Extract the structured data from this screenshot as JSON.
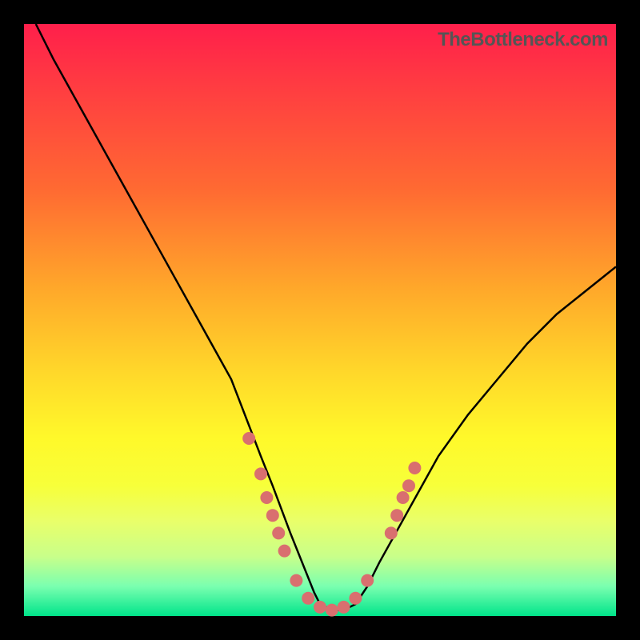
{
  "watermark": "TheBottleneck.com",
  "chart_data": {
    "type": "line",
    "title": "",
    "xlabel": "",
    "ylabel": "",
    "xlim": [
      0,
      100
    ],
    "ylim": [
      0,
      100
    ],
    "series": [
      {
        "name": "bottleneck-curve",
        "x": [
          2,
          5,
          10,
          15,
          20,
          25,
          30,
          35,
          40,
          42,
          45,
          47,
          49,
          50,
          52,
          54,
          56,
          58,
          60,
          65,
          70,
          75,
          80,
          85,
          90,
          95,
          100
        ],
        "y": [
          100,
          94,
          85,
          76,
          67,
          58,
          49,
          40,
          27,
          22,
          14,
          9,
          4,
          2,
          1,
          1,
          2,
          5,
          9,
          18,
          27,
          34,
          40,
          46,
          51,
          55,
          59
        ]
      }
    ],
    "markers": {
      "comment": "salmon dot markers near the valley",
      "name": "valley-markers",
      "color": "#d96f6f",
      "points": [
        {
          "x": 38,
          "y": 30
        },
        {
          "x": 40,
          "y": 24
        },
        {
          "x": 41,
          "y": 20
        },
        {
          "x": 42,
          "y": 17
        },
        {
          "x": 43,
          "y": 14
        },
        {
          "x": 44,
          "y": 11
        },
        {
          "x": 46,
          "y": 6
        },
        {
          "x": 48,
          "y": 3
        },
        {
          "x": 50,
          "y": 1.5
        },
        {
          "x": 52,
          "y": 1
        },
        {
          "x": 54,
          "y": 1.5
        },
        {
          "x": 56,
          "y": 3
        },
        {
          "x": 58,
          "y": 6
        },
        {
          "x": 62,
          "y": 14
        },
        {
          "x": 63,
          "y": 17
        },
        {
          "x": 64,
          "y": 20
        },
        {
          "x": 65,
          "y": 22
        },
        {
          "x": 66,
          "y": 25
        }
      ]
    }
  }
}
